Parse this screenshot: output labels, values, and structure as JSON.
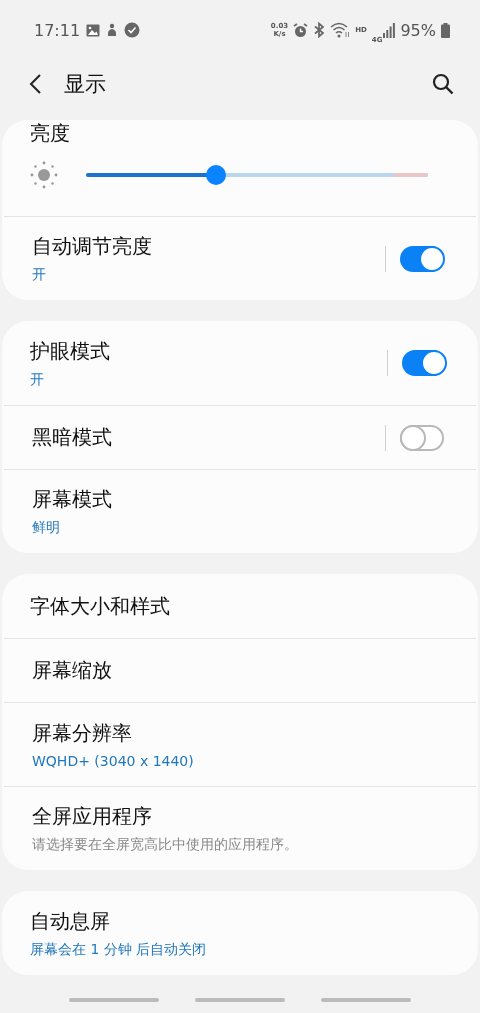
{
  "status_bar": {
    "time": "17:11",
    "net_speed_value": "0.03",
    "net_speed_unit": "K/s",
    "hd": "HD",
    "network": "4G",
    "battery": "95%"
  },
  "header": {
    "title": "显示"
  },
  "cards": [
    {
      "items": [
        {
          "kind": "slider",
          "title": "亮度",
          "level": 0.38
        },
        {
          "kind": "toggle",
          "title": "自动调节亮度",
          "subtitle": "开",
          "muted": false,
          "on": true
        }
      ]
    },
    {
      "items": [
        {
          "kind": "toggle",
          "title": "护眼模式",
          "subtitle": "开",
          "muted": false,
          "on": true
        },
        {
          "kind": "toggle",
          "title": "黑暗模式",
          "on": false
        },
        {
          "kind": "plain",
          "title": "屏幕模式",
          "subtitle": "鲜明",
          "muted": false
        }
      ]
    },
    {
      "items": [
        {
          "kind": "plain",
          "title": "字体大小和样式"
        },
        {
          "kind": "plain",
          "title": "屏幕缩放"
        },
        {
          "kind": "plain",
          "title": "屏幕分辨率",
          "subtitle": "WQHD+ (3040 x 1440)",
          "muted": false
        },
        {
          "kind": "plain",
          "title": "全屏应用程序",
          "subtitle": "请选择要在全屏宽高比中使用的应用程序。",
          "muted": true
        }
      ]
    },
    {
      "items": [
        {
          "kind": "plain",
          "title": "自动息屏",
          "subtitle": "屏幕会在 1 分钟 后自动关闭",
          "muted": false
        }
      ]
    }
  ]
}
